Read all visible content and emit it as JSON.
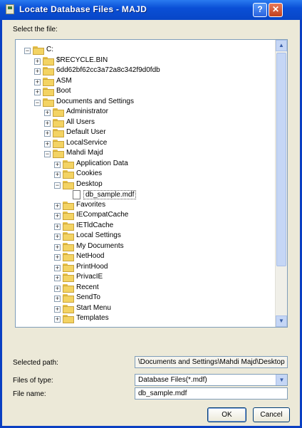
{
  "window": {
    "title": "Locate Database Files - MAJD"
  },
  "select_label": "Select the file:",
  "tree": {
    "nodes": [
      {
        "label": "C:",
        "expander": "−",
        "kind": "folder",
        "level": 0
      },
      {
        "label": "$RECYCLE.BIN",
        "expander": "+",
        "kind": "folder",
        "level": 1
      },
      {
        "label": "6dd62bf62cc3a72a8c342f9d0fdb",
        "expander": "+",
        "kind": "folder",
        "level": 1
      },
      {
        "label": "ASM",
        "expander": "+",
        "kind": "folder",
        "level": 1
      },
      {
        "label": "Boot",
        "expander": "+",
        "kind": "folder",
        "level": 1
      },
      {
        "label": "Documents and Settings",
        "expander": "−",
        "kind": "folder",
        "level": 1
      },
      {
        "label": "Administrator",
        "expander": "+",
        "kind": "folder",
        "level": 2
      },
      {
        "label": "All Users",
        "expander": "+",
        "kind": "folder",
        "level": 2
      },
      {
        "label": "Default User",
        "expander": "+",
        "kind": "folder",
        "level": 2
      },
      {
        "label": "LocalService",
        "expander": "+",
        "kind": "folder",
        "level": 2
      },
      {
        "label": "Mahdi Majd",
        "expander": "−",
        "kind": "folder",
        "level": 2
      },
      {
        "label": "Application Data",
        "expander": "+",
        "kind": "folder",
        "level": 3
      },
      {
        "label": "Cookies",
        "expander": "+",
        "kind": "folder",
        "level": 3
      },
      {
        "label": "Desktop",
        "expander": "−",
        "kind": "folder",
        "level": 3
      },
      {
        "label": "db_sample.mdf",
        "expander": "",
        "kind": "file",
        "level": 4,
        "selected": true
      },
      {
        "label": "Favorites",
        "expander": "+",
        "kind": "folder",
        "level": 3
      },
      {
        "label": "IECompatCache",
        "expander": "+",
        "kind": "folder",
        "level": 3
      },
      {
        "label": "IETldCache",
        "expander": "+",
        "kind": "folder",
        "level": 3
      },
      {
        "label": "Local Settings",
        "expander": "+",
        "kind": "folder",
        "level": 3
      },
      {
        "label": "My Documents",
        "expander": "+",
        "kind": "folder",
        "level": 3
      },
      {
        "label": "NetHood",
        "expander": "+",
        "kind": "folder",
        "level": 3
      },
      {
        "label": "PrintHood",
        "expander": "+",
        "kind": "folder",
        "level": 3
      },
      {
        "label": "PrivacIE",
        "expander": "+",
        "kind": "folder",
        "level": 3
      },
      {
        "label": "Recent",
        "expander": "+",
        "kind": "folder",
        "level": 3
      },
      {
        "label": "SendTo",
        "expander": "+",
        "kind": "folder",
        "level": 3
      },
      {
        "label": "Start Menu",
        "expander": "+",
        "kind": "folder",
        "level": 3
      },
      {
        "label": "Templates",
        "expander": "+",
        "kind": "folder",
        "level": 3
      }
    ]
  },
  "selected_path": {
    "label": "Selected path:",
    "value": "\\Documents and Settings\\Mahdi Majd\\Desktop"
  },
  "files_of_type": {
    "label": "Files of type:",
    "value": "Database Files(*.mdf)"
  },
  "file_name": {
    "label": "File name:",
    "value": "db_sample.mdf"
  },
  "buttons": {
    "ok": "OK",
    "cancel": "Cancel"
  },
  "colors": {
    "titlebar": "#0a4fd6",
    "dialog_bg": "#ece9d8",
    "field_border": "#7f9db9",
    "folder": "#f3d363"
  }
}
